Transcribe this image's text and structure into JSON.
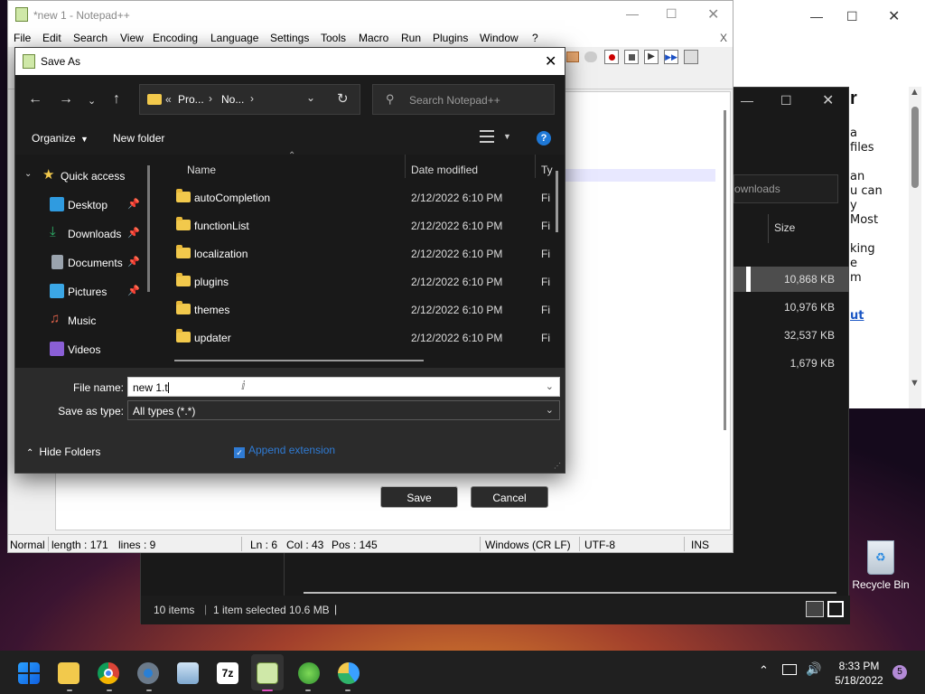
{
  "browser": {
    "title_glyph": "r",
    "content_lines": [
      "a",
      "files",
      "",
      "an",
      "u can",
      "y",
      "Most",
      "",
      "king",
      "e",
      "m"
    ],
    "link_text": "ut"
  },
  "explorer": {
    "search_placeholder": "ownloads",
    "size_header": "Size",
    "sizes": [
      "10,868 KB",
      "10,976 KB",
      "32,537 KB",
      "1,679 KB"
    ],
    "status_items": "10 items",
    "status_selected": "1 item selected",
    "status_size": "10.6 MB"
  },
  "notepad": {
    "title": "*new 1 - Notepad++",
    "menu": [
      "File",
      "Edit",
      "Search",
      "View",
      "Encoding",
      "Language",
      "Settings",
      "Tools",
      "Macro",
      "Run",
      "Plugins",
      "Window",
      "?"
    ],
    "close_x": "X",
    "status": {
      "mode": "Normal",
      "length": "length : 171",
      "lines": "lines : 9",
      "ln": "Ln : 6",
      "col": "Col : 43",
      "pos": "Pos : 145",
      "eol": "Windows (CR LF)",
      "encoding": "UTF-8",
      "ins": "INS"
    }
  },
  "dialog": {
    "title": "Save As",
    "address": {
      "overflow": "«",
      "crumb1": "Pro...",
      "crumb2": "No..."
    },
    "search_placeholder": "Search Notepad++",
    "organize_label": "Organize",
    "new_folder_label": "New folder",
    "tree": {
      "quick_access": "Quick access",
      "items": [
        {
          "label": "Desktop",
          "color": "#2f9be0",
          "pinned": true
        },
        {
          "label": "Downloads",
          "color": "#2fb36a",
          "pinned": true
        },
        {
          "label": "Documents",
          "color": "#9aa3ad",
          "pinned": true
        },
        {
          "label": "Pictures",
          "color": "#3ba7e6",
          "pinned": true
        },
        {
          "label": "Music",
          "color": "#e0624a",
          "pinned": false
        },
        {
          "label": "Videos",
          "color": "#8a5fd6",
          "pinned": false
        }
      ]
    },
    "columns": {
      "name": "Name",
      "date": "Date modified",
      "type": "Ty"
    },
    "files": [
      {
        "name": "autoCompletion",
        "date": "2/12/2022 6:10 PM",
        "type": "Fi"
      },
      {
        "name": "functionList",
        "date": "2/12/2022 6:10 PM",
        "type": "Fi"
      },
      {
        "name": "localization",
        "date": "2/12/2022 6:10 PM",
        "type": "Fi"
      },
      {
        "name": "plugins",
        "date": "2/12/2022 6:10 PM",
        "type": "Fi"
      },
      {
        "name": "themes",
        "date": "2/12/2022 6:10 PM",
        "type": "Fi"
      },
      {
        "name": "updater",
        "date": "2/12/2022 6:10 PM",
        "type": "Fi"
      }
    ],
    "file_name_label": "File name:",
    "file_name_value": "new 1.t",
    "save_type_label": "Save as type:",
    "save_type_value": "All types (*.*)",
    "hide_folders": "Hide Folders",
    "append_extension": "Append extension",
    "save_label": "Save",
    "cancel_label": "Cancel"
  },
  "desktop": {
    "recycle_bin": "Recycle Bin"
  },
  "taskbar": {
    "time": "8:33 PM",
    "date": "5/18/2022",
    "notification_count": "5"
  }
}
